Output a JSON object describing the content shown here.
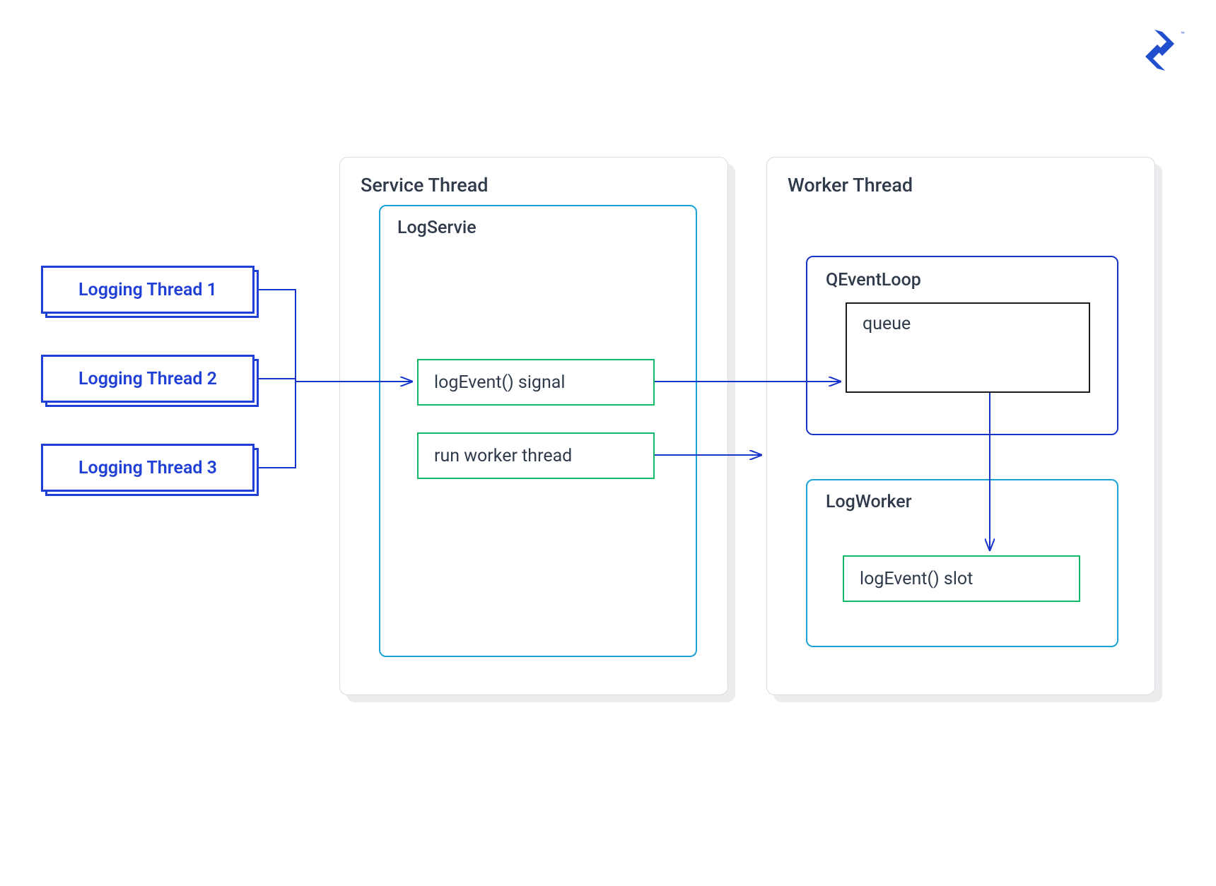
{
  "colors": {
    "blue": "#1f3fd7",
    "deep_blue": "#1736c9",
    "cyan": "#17a3d6",
    "green": "#12b96b",
    "slate": "#2f3a4a",
    "border_gray": "#d9dbe0",
    "shadow_gray": "#ececef",
    "black": "#1c1c1c"
  },
  "logging_threads": [
    {
      "label": "Logging Thread 1"
    },
    {
      "label": "Logging Thread 2"
    },
    {
      "label": "Logging Thread 3"
    }
  ],
  "service_thread": {
    "title": "Service Thread",
    "log_service": {
      "title": "LogServie",
      "signal_label": "logEvent() signal",
      "run_label": "run worker thread"
    }
  },
  "worker_thread": {
    "title": "Worker Thread",
    "qeventloop": {
      "title": "QEventLoop",
      "queue_label": "queue"
    },
    "log_worker": {
      "title": "LogWorker",
      "slot_label": "logEvent() slot"
    }
  },
  "logo_alt": "Toptal logo"
}
